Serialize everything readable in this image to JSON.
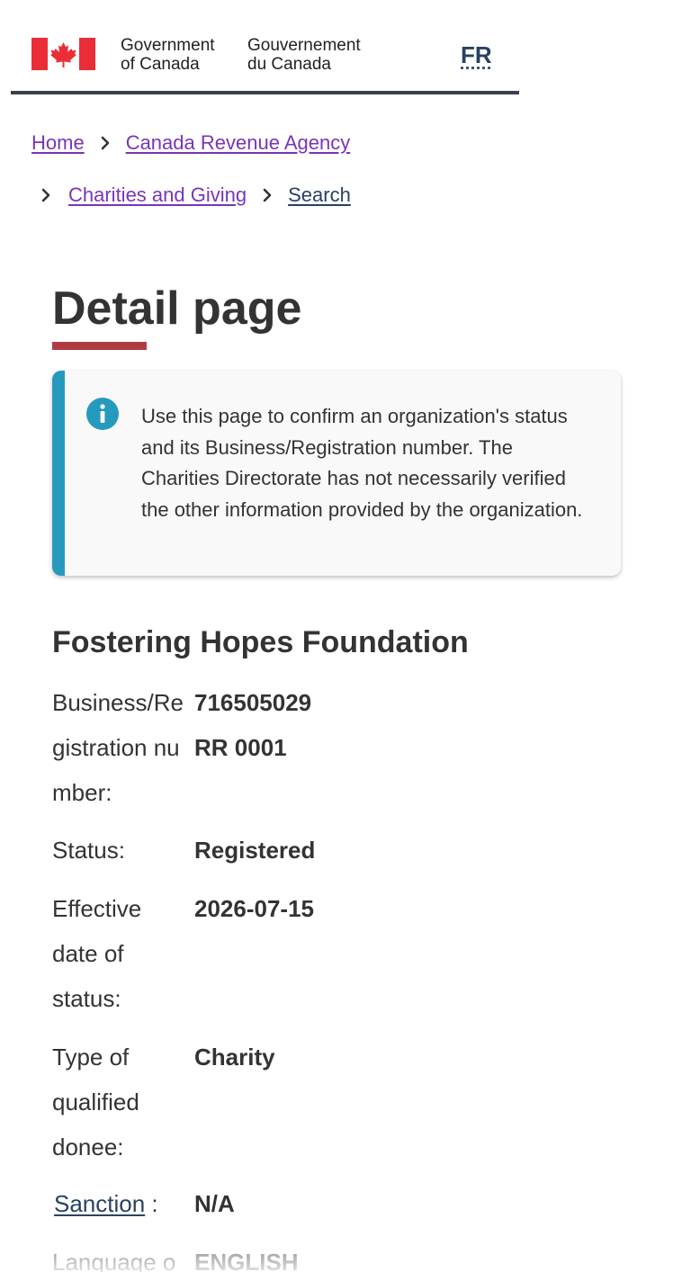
{
  "header": {
    "signature_en_line1": "Government",
    "signature_en_line2": "of Canada",
    "signature_fr_line1": "Gouvernement",
    "signature_fr_line2": "du Canada",
    "language_toggle": "FR",
    "colors": {
      "flag_red": "#eb2d37",
      "rule": "#38414d"
    }
  },
  "breadcrumb": {
    "items": [
      "Home",
      "Canada Revenue Agency",
      "Charities and Giving",
      "Search"
    ]
  },
  "page_title": "Detail page",
  "alert": {
    "icon": "info-icon",
    "text": "Use this page to confirm an organization's status and its Business/Registration number. The Charities Directorate has not necessarily verified the other information provided by the organization."
  },
  "organization": {
    "name": "Fostering Hopes Foundation",
    "fields": {
      "bn_label": "Business/Registration number:",
      "bn_value_1": "716505029",
      "bn_value_2": "RR 0001",
      "status_label": "Status:",
      "status_value": "Registered",
      "effective_label": "Effective date of status:",
      "effective_value": "2026-07-15",
      "donee_label": "Type of qualified donee:",
      "donee_value": "Charity",
      "sanction_label": "Sanction",
      "sanction_value": "N/A",
      "language_label": "Language o",
      "language_value": "ENGLISH"
    }
  }
}
